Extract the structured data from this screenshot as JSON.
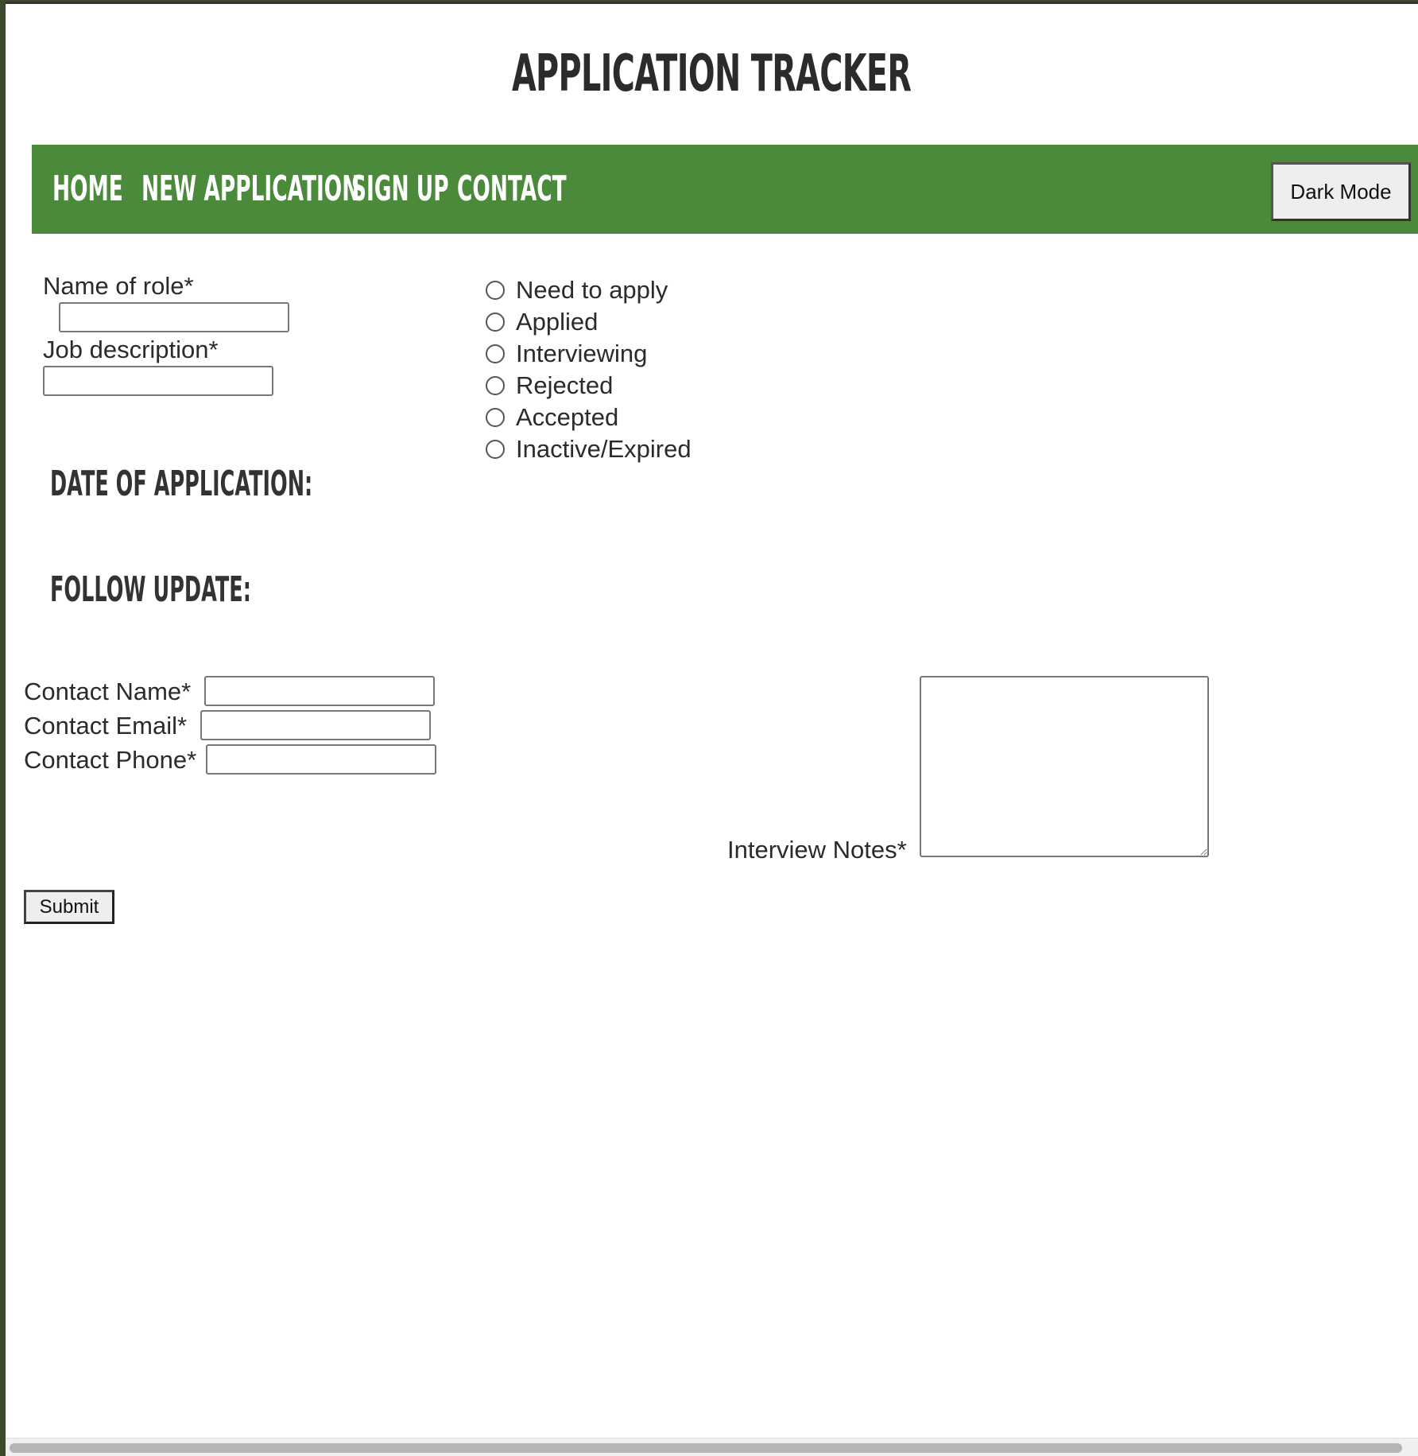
{
  "header": {
    "title": "Application Tracker"
  },
  "nav": {
    "items": [
      {
        "label": "Home"
      },
      {
        "label": "New Application"
      },
      {
        "label": "Sign Up"
      },
      {
        "label": "Contact"
      }
    ],
    "dark_mode_label": "Dark Mode",
    "background_color": "#4a8a3a"
  },
  "form": {
    "role_label": "Name of role*",
    "role_value": "",
    "description_label": "Job description*",
    "description_value": "",
    "status_options": [
      {
        "label": "Need to apply",
        "checked": false
      },
      {
        "label": "Applied",
        "checked": false
      },
      {
        "label": "Interviewing",
        "checked": false
      },
      {
        "label": "Rejected",
        "checked": false
      },
      {
        "label": "Accepted",
        "checked": false
      },
      {
        "label": "Inactive/Expired",
        "checked": false
      }
    ],
    "date_heading": "Date of Application:",
    "follow_heading": "Follow Update:",
    "contact_name_label": "Contact Name*",
    "contact_email_label": "Contact Email*",
    "contact_phone_label": "Contact Phone*",
    "notes_label": "Interview Notes*",
    "submit_label": "Submit"
  }
}
